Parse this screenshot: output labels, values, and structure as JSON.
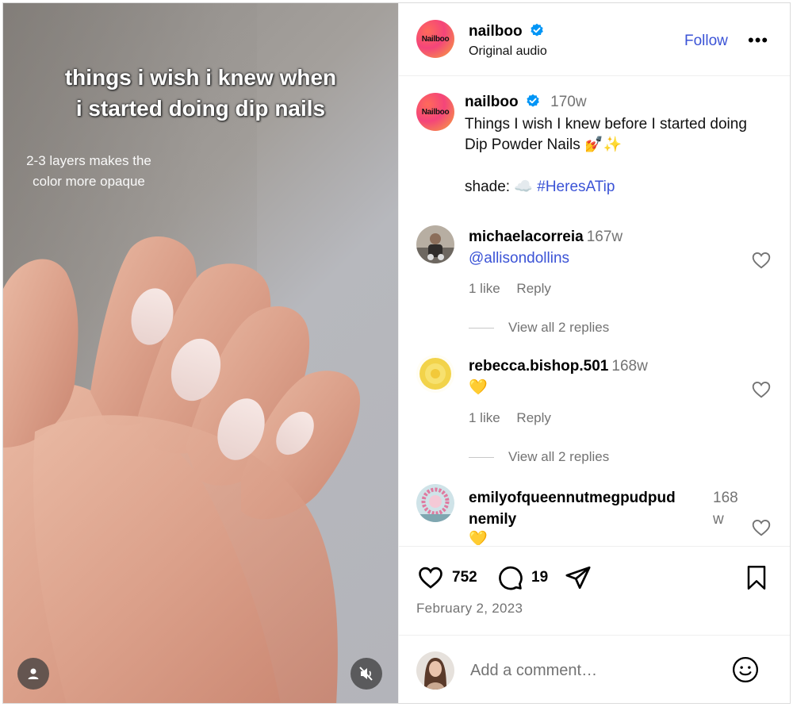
{
  "video": {
    "caption_line1": "things i wish i knew when",
    "caption_line2": "i started doing dip nails",
    "subcaption_line1": "2-3 layers makes the",
    "subcaption_line2": "color more opaque",
    "user_icon": "user-icon",
    "mute_icon": "muted-speaker-icon"
  },
  "header": {
    "username": "nailboo",
    "logo_text": "Nailboo",
    "audio": "Original audio",
    "follow_label": "Follow",
    "more_label": "•••"
  },
  "post": {
    "username": "nailboo",
    "age": "170w",
    "text": "Things I wish I knew before I started doing Dip Powder Nails 💅✨",
    "shade_label": "shade: ☁️",
    "hashtag": "#HeresATip"
  },
  "comments": [
    {
      "username": "michaelacorreia",
      "age": "167w",
      "text": "@allisondollins",
      "likes": "1 like",
      "reply_label": "Reply",
      "view_replies": "View all 2 replies"
    },
    {
      "username": "rebecca.bishop.501",
      "age": "168w",
      "text": "💛",
      "likes": "1 like",
      "reply_label": "Reply",
      "view_replies": "View all 2 replies"
    },
    {
      "username_line1": "emilyofqueennutmegpudpud",
      "username_line2": "nemily",
      "age_line1": "168",
      "age_line2": "w",
      "text": "💛"
    }
  ],
  "actions": {
    "like_count": "752",
    "comment_count": "19",
    "date": "February 2, 2023"
  },
  "add_comment": {
    "placeholder": "Add a comment…"
  },
  "colors": {
    "link": "#3b53d6",
    "muted": "#737373",
    "verified": "#0095f6"
  }
}
